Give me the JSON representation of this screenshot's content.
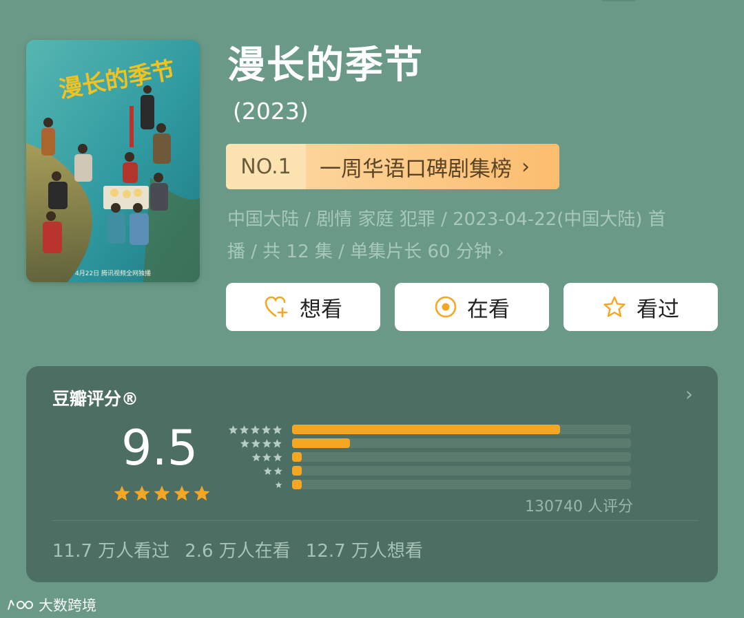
{
  "show": {
    "title": "漫长的季节",
    "year": "(2023)",
    "poster": {
      "title_art": "漫长的季节",
      "credits": "4月22日 腾讯视频全网独播"
    }
  },
  "ranking": {
    "number": "NO.1",
    "name": "一周华语口碑剧集榜",
    "chevron": "›"
  },
  "meta": {
    "line1": "中国大陆 / 剧情 家庭 犯罪 / 2023-04-22(中国大陆) 首",
    "line2": "播 / 共 12 集 / 单集片长 60 分钟",
    "chevron": "›"
  },
  "actions": [
    {
      "label": "想看",
      "icon": "heart-plus-icon"
    },
    {
      "label": "在看",
      "icon": "target-icon"
    },
    {
      "label": "看过",
      "icon": "star-outline-icon"
    }
  ],
  "rating": {
    "title": "豆瓣评分®",
    "score": "9.5",
    "stars": 5,
    "distribution": [
      {
        "stars": 5,
        "fraction": 0.79
      },
      {
        "stars": 4,
        "fraction": 0.17
      },
      {
        "stars": 3,
        "fraction": 0.025
      },
      {
        "stars": 2,
        "fraction": 0.025
      },
      {
        "stars": 1,
        "fraction": 0.025
      }
    ],
    "count": "130740 人评分",
    "chevron": "›"
  },
  "stats": {
    "watched": "11.7 万人看过",
    "watching": "2.6 万人在看",
    "want": "12.7 万人想看"
  },
  "watermark": {
    "text": "大数跨境"
  },
  "colors": {
    "background": "#6a9a87",
    "card": "#4d6e62",
    "accent_orange": "#f5a623",
    "rank_badge": "#fbbd6e"
  }
}
